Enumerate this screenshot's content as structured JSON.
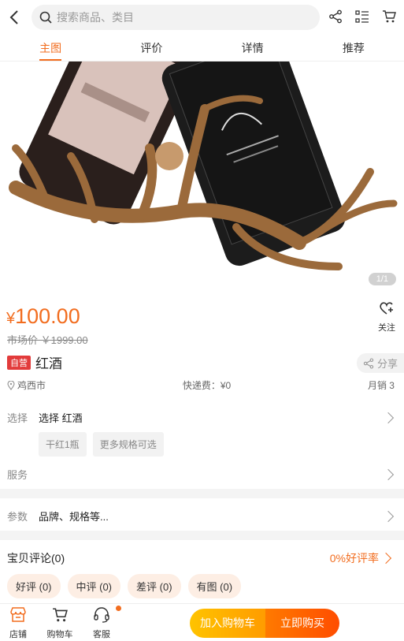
{
  "search": {
    "placeholder": "搜索商品、类目"
  },
  "tabs": [
    {
      "label": "主图",
      "active": true
    },
    {
      "label": "评价"
    },
    {
      "label": "详情"
    },
    {
      "label": "推荐"
    }
  ],
  "hero": {
    "counter": "1/1"
  },
  "product": {
    "price_symbol": "¥",
    "price": "100.00",
    "market_price": "市场价 ￥1999.00",
    "follow_label": "关注",
    "badge": "自营",
    "title": "红酒",
    "share_label": "分享",
    "location": "鸡西市",
    "shipping": "快递费：¥0",
    "monthly_sales": "月销 3"
  },
  "spec": {
    "label": "选择",
    "value": "选择 红酒",
    "options": [
      "干红1瓶",
      "更多规格可选"
    ]
  },
  "service": {
    "label": "服务"
  },
  "params": {
    "label": "参数",
    "value": "品牌、规格等..."
  },
  "reviews": {
    "title": "宝贝评论(0)",
    "rate": "0%好评率",
    "filters": [
      "好评 (0)",
      "中评 (0)",
      "差评 (0)",
      "有图 (0)"
    ]
  },
  "bottom_bar": {
    "store_label": "店铺",
    "cart_label": "购物车",
    "service_label": "客服",
    "add_to_cart": "加入购物车",
    "buy_now": "立即购买"
  },
  "colors": {
    "accent": "#f26d1f",
    "badge": "#e23b3b"
  }
}
